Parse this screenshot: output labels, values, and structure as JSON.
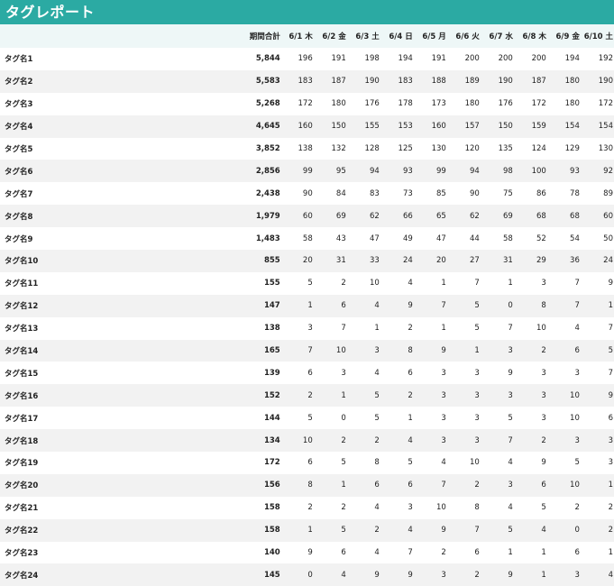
{
  "report": {
    "title": "タグレポート"
  },
  "table": {
    "columns": {
      "tag": "",
      "total": "期間合計",
      "days": [
        "6/1 木",
        "6/2 金",
        "6/3 土",
        "6/4 日",
        "6/5 月",
        "6/6 火",
        "6/7 水",
        "6/8 木",
        "6/9 金",
        "6/10 土"
      ]
    },
    "rows": [
      {
        "name": "タグ名1",
        "total": "5,844",
        "values": [
          "196",
          "191",
          "198",
          "194",
          "191",
          "200",
          "200",
          "200",
          "194",
          "192"
        ]
      },
      {
        "name": "タグ名2",
        "total": "5,583",
        "values": [
          "183",
          "187",
          "190",
          "183",
          "188",
          "189",
          "190",
          "187",
          "180",
          "190"
        ]
      },
      {
        "name": "タグ名3",
        "total": "5,268",
        "values": [
          "172",
          "180",
          "176",
          "178",
          "173",
          "180",
          "176",
          "172",
          "180",
          "172"
        ]
      },
      {
        "name": "タグ名4",
        "total": "4,645",
        "values": [
          "160",
          "150",
          "155",
          "153",
          "160",
          "157",
          "150",
          "159",
          "154",
          "154"
        ]
      },
      {
        "name": "タグ名5",
        "total": "3,852",
        "values": [
          "138",
          "132",
          "128",
          "125",
          "130",
          "120",
          "135",
          "124",
          "129",
          "130"
        ]
      },
      {
        "name": "タグ名6",
        "total": "2,856",
        "values": [
          "99",
          "95",
          "94",
          "93",
          "99",
          "94",
          "98",
          "100",
          "93",
          "92"
        ]
      },
      {
        "name": "タグ名7",
        "total": "2,438",
        "values": [
          "90",
          "84",
          "83",
          "73",
          "85",
          "90",
          "75",
          "86",
          "78",
          "89"
        ]
      },
      {
        "name": "タグ名8",
        "total": "1,979",
        "values": [
          "60",
          "69",
          "62",
          "66",
          "65",
          "62",
          "69",
          "68",
          "68",
          "60"
        ]
      },
      {
        "name": "タグ名9",
        "total": "1,483",
        "values": [
          "58",
          "43",
          "47",
          "49",
          "47",
          "44",
          "58",
          "52",
          "54",
          "50"
        ]
      },
      {
        "name": "タグ名10",
        "total": "855",
        "values": [
          "20",
          "31",
          "33",
          "24",
          "20",
          "27",
          "31",
          "29",
          "36",
          "24"
        ]
      },
      {
        "name": "タグ名11",
        "total": "155",
        "values": [
          "5",
          "2",
          "10",
          "4",
          "1",
          "7",
          "1",
          "3",
          "7",
          "9"
        ]
      },
      {
        "name": "タグ名12",
        "total": "147",
        "values": [
          "1",
          "6",
          "4",
          "9",
          "7",
          "5",
          "0",
          "8",
          "7",
          "1"
        ]
      },
      {
        "name": "タグ名13",
        "total": "138",
        "values": [
          "3",
          "7",
          "1",
          "2",
          "1",
          "5",
          "7",
          "10",
          "4",
          "7"
        ]
      },
      {
        "name": "タグ名14",
        "total": "165",
        "values": [
          "7",
          "10",
          "3",
          "8",
          "9",
          "1",
          "3",
          "2",
          "6",
          "5"
        ]
      },
      {
        "name": "タグ名15",
        "total": "139",
        "values": [
          "6",
          "3",
          "4",
          "6",
          "3",
          "3",
          "9",
          "3",
          "3",
          "7"
        ]
      },
      {
        "name": "タグ名16",
        "total": "152",
        "values": [
          "2",
          "1",
          "5",
          "2",
          "3",
          "3",
          "3",
          "3",
          "10",
          "9"
        ]
      },
      {
        "name": "タグ名17",
        "total": "144",
        "values": [
          "5",
          "0",
          "5",
          "1",
          "3",
          "3",
          "5",
          "3",
          "10",
          "6"
        ]
      },
      {
        "name": "タグ名18",
        "total": "134",
        "values": [
          "10",
          "2",
          "2",
          "4",
          "3",
          "3",
          "7",
          "2",
          "3",
          "3"
        ]
      },
      {
        "name": "タグ名19",
        "total": "172",
        "values": [
          "6",
          "5",
          "8",
          "5",
          "4",
          "10",
          "4",
          "9",
          "5",
          "3"
        ]
      },
      {
        "name": "タグ名20",
        "total": "156",
        "values": [
          "8",
          "1",
          "6",
          "6",
          "7",
          "2",
          "3",
          "6",
          "10",
          "1"
        ]
      },
      {
        "name": "タグ名21",
        "total": "158",
        "values": [
          "2",
          "2",
          "4",
          "3",
          "10",
          "8",
          "4",
          "5",
          "2",
          "2"
        ]
      },
      {
        "name": "タグ名22",
        "total": "158",
        "values": [
          "1",
          "5",
          "2",
          "4",
          "9",
          "7",
          "5",
          "4",
          "0",
          "2"
        ]
      },
      {
        "name": "タグ名23",
        "total": "140",
        "values": [
          "9",
          "6",
          "4",
          "7",
          "2",
          "6",
          "1",
          "1",
          "6",
          "1"
        ]
      },
      {
        "name": "タグ名24",
        "total": "145",
        "values": [
          "0",
          "4",
          "9",
          "9",
          "3",
          "2",
          "9",
          "1",
          "3",
          "4"
        ]
      }
    ]
  },
  "colors": {
    "header_bar": "#2baaa3",
    "header_row": "#eef7f7",
    "stripe": "#f2f2f2"
  }
}
